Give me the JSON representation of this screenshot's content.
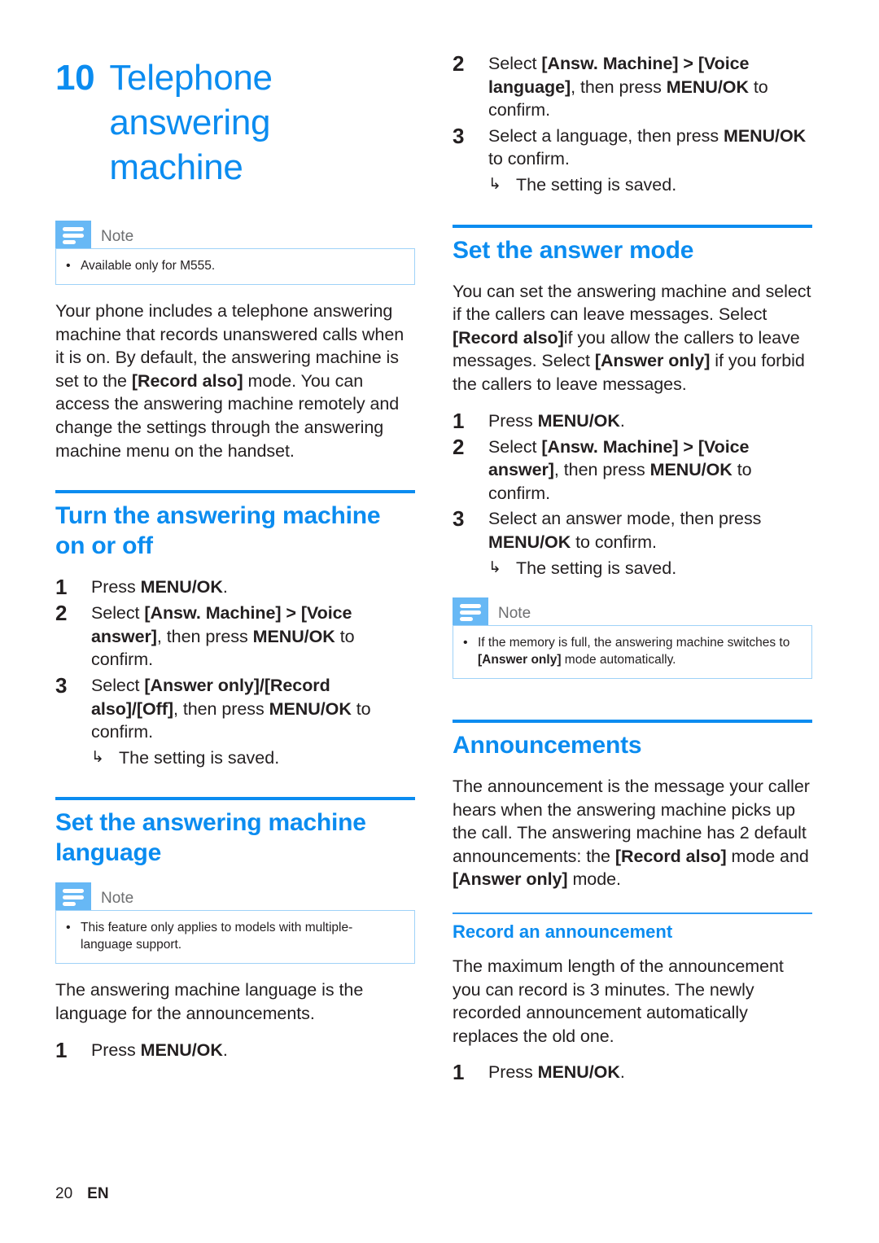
{
  "chapter": {
    "number": "10",
    "title_lines": [
      "Telephone",
      "answering",
      "machine"
    ]
  },
  "colors": {
    "accent_blue": "#0b8cf0",
    "note_icon_blue": "#67b8f5",
    "note_border_blue": "#9fd2f8",
    "body_text": "#231f20",
    "note_label_gray": "#6d6e70"
  },
  "icons": {
    "note_icon": "note-lines-icon",
    "result_arrow": "↳"
  },
  "left_column": {
    "note_intro": {
      "label": "Note",
      "items": [
        "Available only for M555."
      ]
    },
    "intro_paragraph_pre": "Your phone includes a telephone answering machine that records unanswered calls when it is on. By default, the answering machine is set to the ",
    "intro_paragraph_bold": "[Record also]",
    "intro_paragraph_post": " mode. You can access the answering machine remotely and change the settings through the answering machine menu on the handset.",
    "section_turn": {
      "heading": "Turn the answering machine on or off",
      "steps": [
        {
          "num": "1",
          "pre": "Press ",
          "bold": "MENU/OK",
          "post": "."
        },
        {
          "num": "2",
          "pre": "Select ",
          "bold": "[Answ. Machine] > [Voice answer]",
          "post": ", then press ",
          "bold2": "MENU/OK",
          "post2": " to confirm."
        },
        {
          "num": "3",
          "pre": "Select ",
          "bold": "[Answer only]/[Record also]/[Off]",
          "post": ", then press ",
          "bold2": "MENU/OK",
          "post2": " to confirm."
        }
      ],
      "result": "The setting is saved."
    },
    "section_language": {
      "heading": "Set the answering machine language",
      "note": {
        "label": "Note",
        "items": [
          "This feature only applies to models with multiple-language support."
        ]
      },
      "paragraph": "The answering machine language is the language for the announcements.",
      "steps": [
        {
          "num": "1",
          "pre": "Press ",
          "bold": "MENU/OK",
          "post": "."
        }
      ]
    }
  },
  "right_column": {
    "continued_steps": [
      {
        "num": "2",
        "pre": "Select ",
        "bold": "[Answ. Machine] > [Voice language]",
        "post": ", then press ",
        "bold2": "MENU/OK",
        "post2": " to confirm."
      },
      {
        "num": "3",
        "pre": "Select a language, then press ",
        "bold": "MENU/OK",
        "post": " to confirm."
      }
    ],
    "continued_result": "The setting is saved.",
    "section_answer_mode": {
      "heading": "Set the answer mode",
      "paragraph_pre": "You can set the answering machine and select if the callers can leave messages. Select ",
      "paragraph_bold1": "[Record also]",
      "paragraph_mid": "if you allow the callers to leave messages. Select ",
      "paragraph_bold2": "[Answer only]",
      "paragraph_post": " if you forbid the callers to leave messages.",
      "steps": [
        {
          "num": "1",
          "pre": "Press ",
          "bold": "MENU/OK",
          "post": "."
        },
        {
          "num": "2",
          "pre": "Select ",
          "bold": "[Answ. Machine] > [Voice answer]",
          "post": ", then press ",
          "bold2": "MENU/OK",
          "post2": " to confirm."
        },
        {
          "num": "3",
          "pre": "Select an answer mode, then press ",
          "bold": "MENU/OK",
          "post": " to confirm."
        }
      ],
      "result": "The setting is saved.",
      "note": {
        "label": "Note",
        "item_pre": "If the memory is full, the answering machine switches to ",
        "item_bold": "[Answer only]",
        "item_post": " mode automatically."
      }
    },
    "section_announcements": {
      "heading": "Announcements",
      "paragraph_pre": "The announcement is the message your caller hears when the answering machine picks up the call. The answering machine has 2 default announcements: the ",
      "paragraph_bold1": "[Record also]",
      "paragraph_mid": " mode and ",
      "paragraph_bold2": "[Answer only]",
      "paragraph_post": " mode.",
      "subsection": {
        "heading": "Record an announcement",
        "paragraph": "The maximum length of the announcement you can record is 3 minutes. The newly recorded announcement automatically replaces the old one.",
        "steps": [
          {
            "num": "1",
            "pre": "Press ",
            "bold": "MENU/OK",
            "post": "."
          }
        ]
      }
    }
  },
  "footer": {
    "page_number": "20",
    "language_code": "EN"
  }
}
